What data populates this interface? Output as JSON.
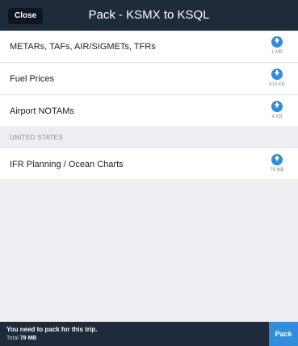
{
  "header": {
    "close_label": "Close",
    "title": "Pack - KSMX to KSQL"
  },
  "rows": [
    {
      "label": "METARs, TAFs, AIR/SIGMETs, TFRs",
      "size": "1 MB",
      "icon": "download-icon"
    },
    {
      "label": "Fuel Prices",
      "size": "614 KB",
      "icon": "download-icon"
    },
    {
      "label": "Airport NOTAMs",
      "size": "4 KB",
      "icon": "download-icon"
    }
  ],
  "section": {
    "title": "UNITED STATES",
    "rows": [
      {
        "label": "IFR Planning / Ocean Charts",
        "size": "76 MB",
        "icon": "download-icon"
      }
    ]
  },
  "footer": {
    "message": "You need to pack for this trip.",
    "total_label": "Total",
    "total_value": "78 MB",
    "pack_label": "Pack"
  },
  "colors": {
    "header_bg": "#1f2a3a",
    "accent": "#2f8ddc",
    "section_bg": "#eceef1"
  }
}
